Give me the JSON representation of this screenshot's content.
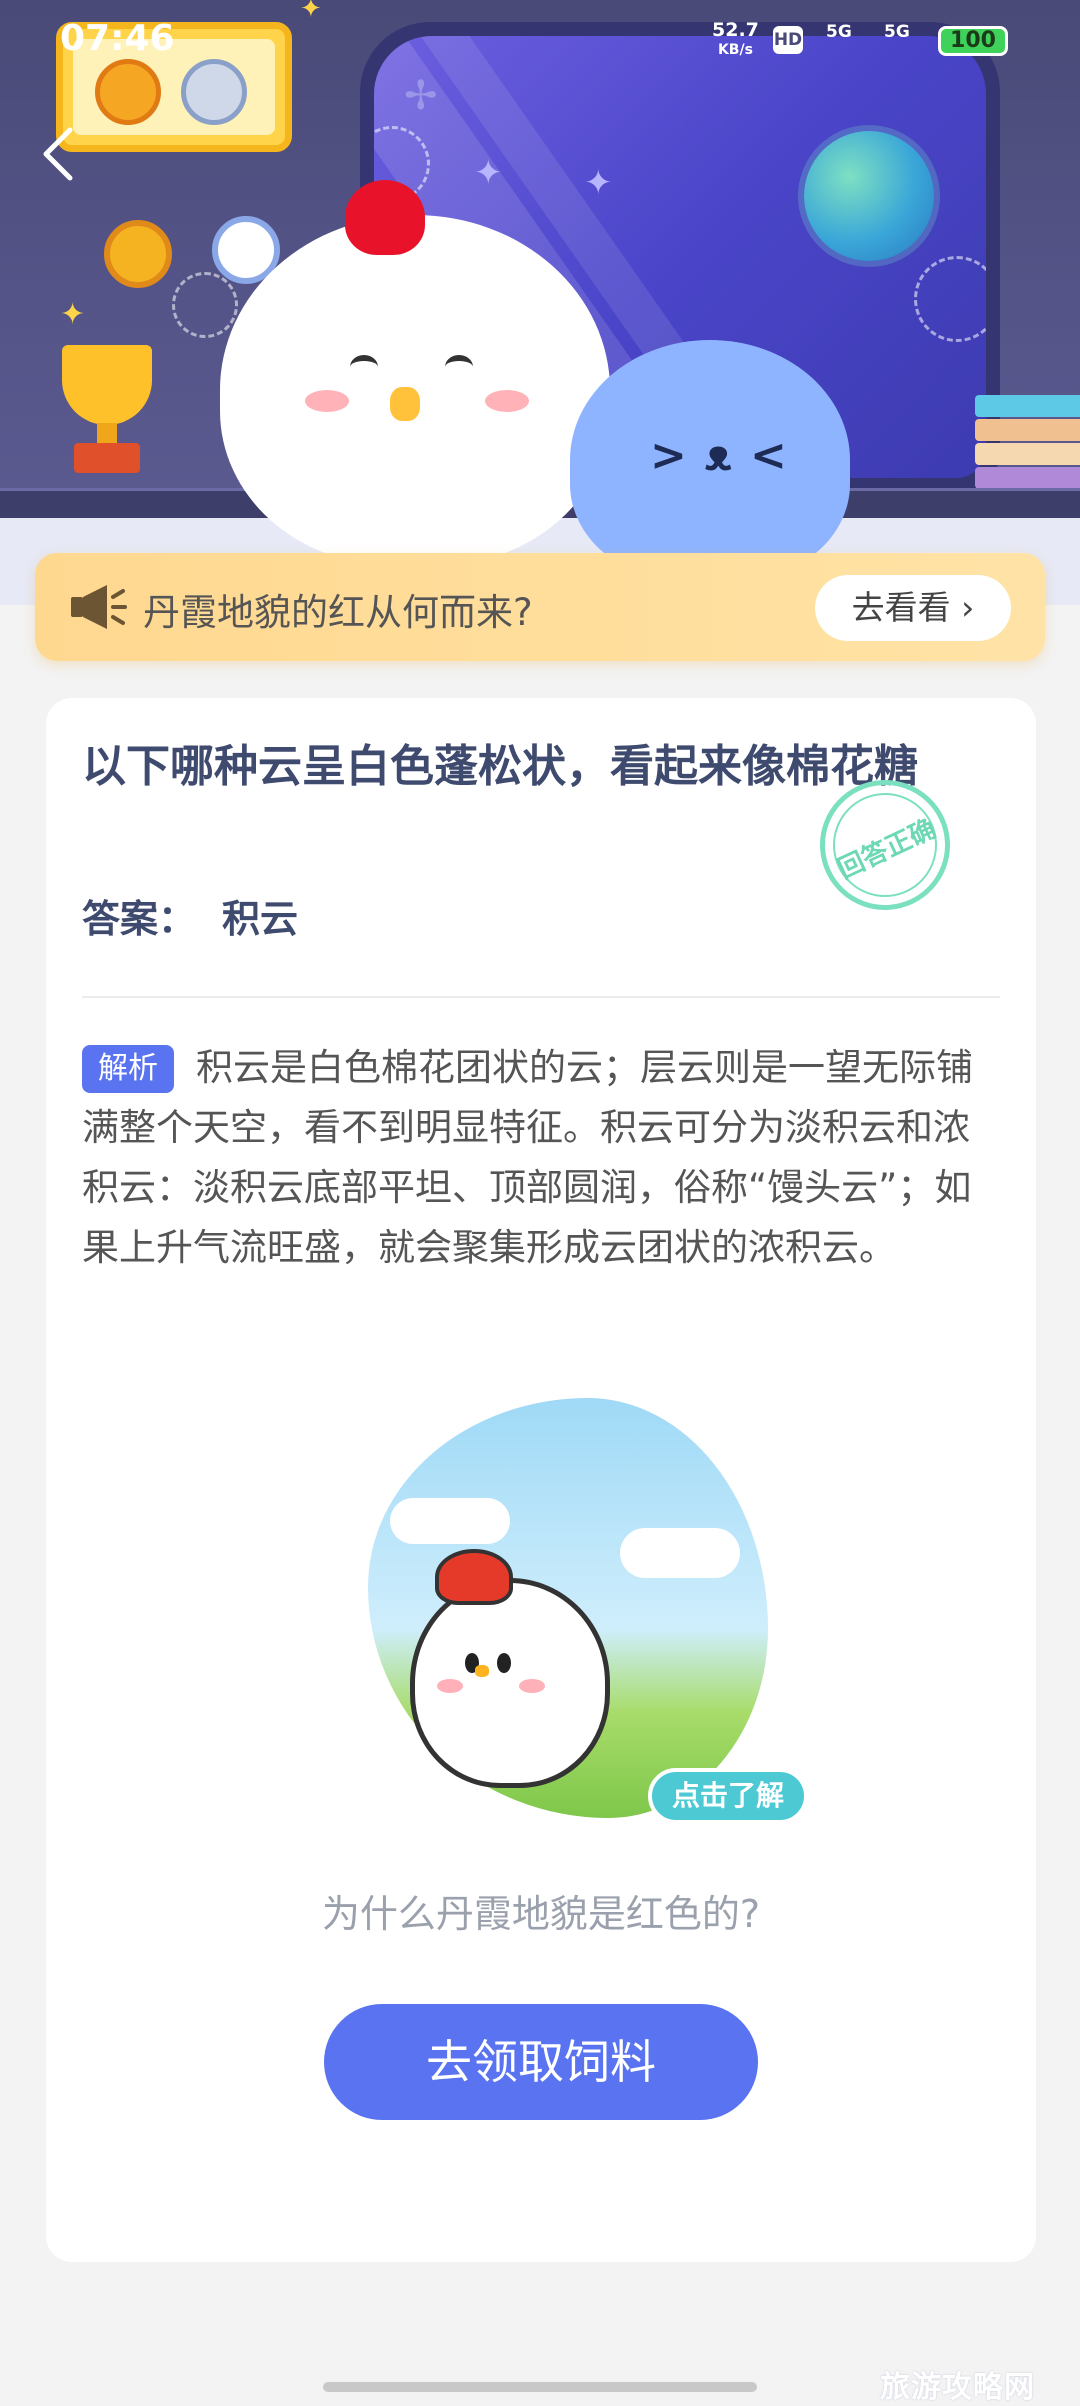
{
  "status_bar": {
    "time": "07:46",
    "net_speed_value": "52.7",
    "net_speed_unit": "KB/s",
    "hd": "HD",
    "signal1": "5G",
    "signal2": "5G",
    "battery": "100"
  },
  "banner": {
    "text": "丹霞地貌的红从何而来?",
    "button": "去看看 ›"
  },
  "question": {
    "title": "以下哪种云呈白色蓬松状，看起来像棉花糖",
    "answer_label": "答案：",
    "answer_value": "积云",
    "stamp": "回答正确"
  },
  "analysis": {
    "tag": "解析",
    "text": "积云是白色棉花团状的云；层云则是一望无际铺满整个天空，看不到明显特征。积云可分为淡积云和浓积云：淡积云底部平坦、顶部圆润，俗称“馒头云”；如果上升气流旺盛，就会聚集形成云团状的浓积云。"
  },
  "illustration": {
    "pill": "点击了解",
    "caption": "为什么丹霞地貌是红色的?"
  },
  "cta": {
    "label": "去领取饲料"
  },
  "watermark": "旅游攻略网",
  "colors": {
    "accent": "#5a73f0",
    "banner": "#ffdfa0",
    "title_text": "#3e4a6e",
    "stamp": "#7be0c0"
  }
}
